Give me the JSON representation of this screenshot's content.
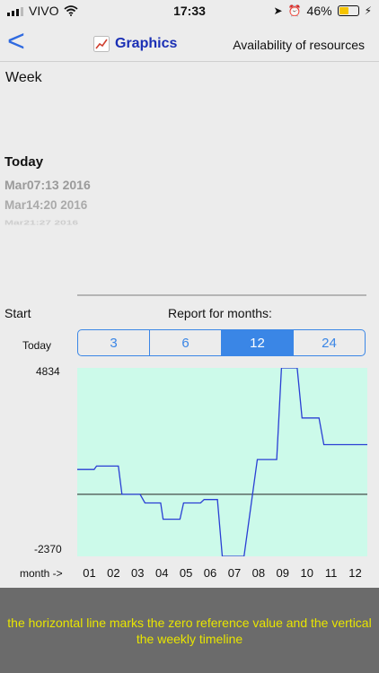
{
  "status": {
    "carrier": "VIVO",
    "time": "17:33",
    "battery": "46%",
    "battery_level": 0.46
  },
  "nav": {
    "back_label": "<",
    "title": "Graphics",
    "right": "Availability of resources"
  },
  "week_label": "Week",
  "today_heading": "Today",
  "dates": [
    "Mar07:13 2016",
    "Mar14:20 2016",
    "Mar21:27 2016"
  ],
  "start_label": "Start",
  "report_label": "Report for months:",
  "today_small": "Today",
  "segments": [
    {
      "label": "3",
      "selected": false
    },
    {
      "label": "6",
      "selected": false
    },
    {
      "label": "12",
      "selected": true
    },
    {
      "label": "24",
      "selected": false
    }
  ],
  "month_axis_label": "month ->",
  "footer_text": "the horizontal line marks the zero reference value and the vertical the weekly timeline",
  "chart_data": {
    "type": "line",
    "y_max_label": "4834",
    "y_min_label": "-2370",
    "ylim": [
      -2370,
      4834
    ],
    "categories": [
      "01",
      "02",
      "03",
      "04",
      "05",
      "06",
      "07",
      "08",
      "09",
      "10",
      "11",
      "12"
    ],
    "x_range": [
      0.5,
      12.5
    ],
    "series": [
      {
        "x": [
          0.5,
          1.2,
          1.3,
          2.2,
          2.35,
          3.1,
          3.3,
          3.95,
          4.05,
          4.75,
          4.9,
          5.6,
          5.75,
          6.3,
          6.5,
          7.2,
          7.4,
          7.95,
          8.05,
          8.75,
          8.95,
          9.6,
          9.8,
          10.5,
          10.7,
          12.5
        ],
        "y": [
          950,
          950,
          1080,
          1080,
          0,
          0,
          -330,
          -330,
          -950,
          -950,
          -330,
          -330,
          -200,
          -200,
          -2370,
          -2370,
          -2370,
          1330,
          1330,
          1330,
          4834,
          4834,
          2920,
          2920,
          1900,
          1900
        ]
      }
    ],
    "zero_line": 0,
    "line_color": "#2a3fd4",
    "background_color": "#ccfaea",
    "zero_line_color": "#222222"
  }
}
